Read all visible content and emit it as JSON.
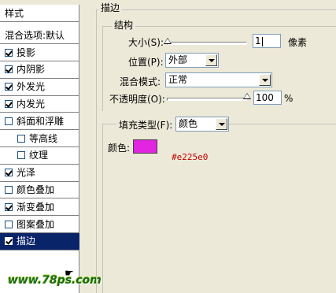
{
  "style_list": {
    "header": "样式",
    "blend_options": "混合选项:默认",
    "items": [
      {
        "label": "投影",
        "checked": true,
        "sub": false
      },
      {
        "label": "内阴影",
        "checked": true,
        "sub": false
      },
      {
        "label": "外发光",
        "checked": true,
        "sub": false
      },
      {
        "label": "内发光",
        "checked": true,
        "sub": false
      },
      {
        "label": "斜面和浮雕",
        "checked": false,
        "sub": false
      },
      {
        "label": "等高线",
        "checked": false,
        "sub": true
      },
      {
        "label": "纹理",
        "checked": false,
        "sub": true
      },
      {
        "label": "光泽",
        "checked": true,
        "sub": false
      },
      {
        "label": "颜色叠加",
        "checked": false,
        "sub": false
      },
      {
        "label": "渐变叠加",
        "checked": true,
        "sub": false
      },
      {
        "label": "图案叠加",
        "checked": false,
        "sub": false
      },
      {
        "label": "描边",
        "checked": true,
        "sub": false,
        "selected": true
      }
    ]
  },
  "watermark": {
    "text": "www.78ps.com"
  },
  "stroke": {
    "title": "描边",
    "structure": {
      "title": "结构",
      "size_label": "大小(S):",
      "size_value": "1",
      "size_unit": "像素",
      "size_slider": 0.01,
      "position_label": "位置(P):",
      "position_value": "外部",
      "blend_label": "混合模式:",
      "blend_value": "正常",
      "opacity_label": "不透明度(O):",
      "opacity_value": "100",
      "opacity_unit": "%",
      "opacity_slider": 1.0
    },
    "fill": {
      "type_label": "填充类型(F):",
      "type_value": "颜色",
      "color_label": "颜色:",
      "color": "#e225e0",
      "hex_annotation": "#e225e0"
    }
  }
}
